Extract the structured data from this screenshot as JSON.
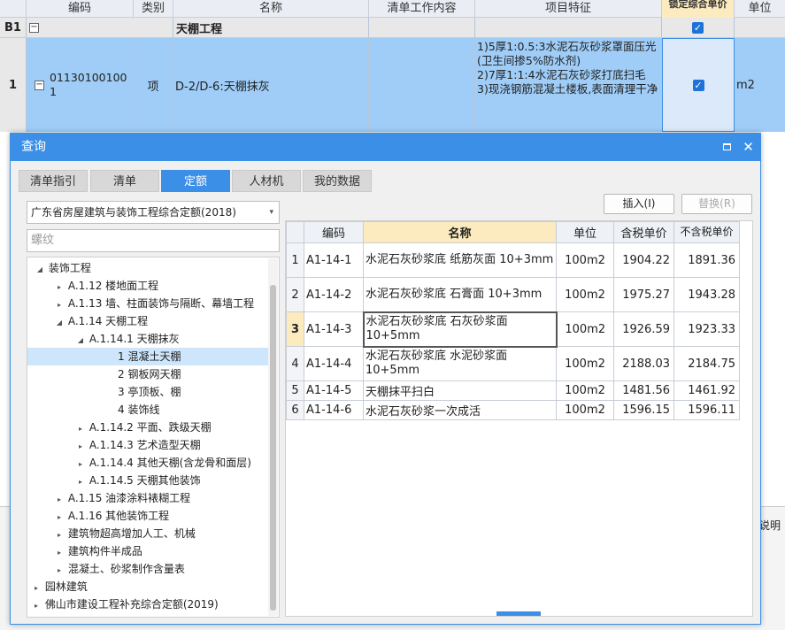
{
  "bg_table": {
    "headers": [
      "编码",
      "类别",
      "名称",
      "清单工作内容",
      "项目特征",
      "锁定综合单价",
      "单位"
    ],
    "b1_row": {
      "index": "B1",
      "name": "天棚工程"
    },
    "row1": {
      "index": "1",
      "code": "011301001001",
      "category": "项",
      "name": "D-2/D-6:天棚抹灰",
      "features": [
        "1)5厚1:0.5:3水泥石灰砂浆罩面压光(卫生间掺5%防水剂)",
        "2)7厚1:1:4水泥石灰砂浆打底扫毛",
        "3)现浇钢筋混凝土楼板,表面清理干净"
      ],
      "unit": "m2"
    },
    "right_edge_text": "说明",
    "collapse_symbol": "−",
    "check_symbol": "✓"
  },
  "dialog": {
    "title": "查询",
    "tabs": [
      "清单指引",
      "清单",
      "定额",
      "人材机",
      "我的数据"
    ],
    "active_tab": "定额",
    "quota_library": "广东省房屋建筑与装饰工程综合定额(2018)",
    "search_placeholder": "螺纹",
    "insert_button": "插入(I)",
    "replace_button": "替换(R)",
    "tree": [
      {
        "label": "装饰工程",
        "level": 1,
        "state": "expanded"
      },
      {
        "label": "A.1.12 楼地面工程",
        "level": 2,
        "state": "collapsed"
      },
      {
        "label": "A.1.13 墙、柱面装饰与隔断、幕墙工程",
        "level": 2,
        "state": "collapsed"
      },
      {
        "label": "A.1.14 天棚工程",
        "level": 2,
        "state": "expanded"
      },
      {
        "label": "A.1.14.1 天棚抹灰",
        "level": 3,
        "state": "expanded"
      },
      {
        "label": "1 混凝土天棚",
        "level": 4,
        "state": "leaf",
        "selected": true
      },
      {
        "label": "2 钢板网天棚",
        "level": 4,
        "state": "leaf"
      },
      {
        "label": "3 亭顶板、棚",
        "level": 4,
        "state": "leaf"
      },
      {
        "label": "4 装饰线",
        "level": 4,
        "state": "leaf"
      },
      {
        "label": "A.1.14.2 平面、跌级天棚",
        "level": 3,
        "state": "collapsed"
      },
      {
        "label": "A.1.14.3 艺术造型天棚",
        "level": 3,
        "state": "collapsed"
      },
      {
        "label": "A.1.14.4 其他天棚(含龙骨和面层)",
        "level": 3,
        "state": "collapsed"
      },
      {
        "label": "A.1.14.5 天棚其他装饰",
        "level": 3,
        "state": "collapsed"
      },
      {
        "label": "A.1.15 油漆涂料裱糊工程",
        "level": 2,
        "state": "collapsed"
      },
      {
        "label": "A.1.16 其他装饰工程",
        "level": 2,
        "state": "collapsed"
      },
      {
        "label": "建筑物超高增加人工、机械",
        "level": 2,
        "state": "collapsed"
      },
      {
        "label": "建筑构件半成品",
        "level": 2,
        "state": "collapsed"
      },
      {
        "label": "混凝土、砂浆制作含量表",
        "level": 2,
        "state": "collapsed"
      },
      {
        "label": "园林建筑",
        "level": 1,
        "state": "collapsed"
      },
      {
        "label": "佛山市建设工程补充综合定额(2019)",
        "level": 1,
        "state": "collapsed"
      }
    ],
    "grid": {
      "headers": [
        "",
        "编码",
        "名称",
        "单位",
        "含税单价",
        "不含税单价"
      ],
      "rows": [
        {
          "idx": "1",
          "code": "A1-14-1",
          "name": "水泥石灰砂浆底 纸筋灰面 10+3mm",
          "unit": "100m2",
          "price_tax": "1904.22",
          "price_notax": "1891.36"
        },
        {
          "idx": "2",
          "code": "A1-14-2",
          "name": "水泥石灰砂浆底 石膏面 10+3mm",
          "unit": "100m2",
          "price_tax": "1975.27",
          "price_notax": "1943.28"
        },
        {
          "idx": "3",
          "code": "A1-14-3",
          "name": "水泥石灰砂浆底 石灰砂浆面 10+5mm",
          "unit": "100m2",
          "price_tax": "1926.59",
          "price_notax": "1923.33",
          "selected": true
        },
        {
          "idx": "4",
          "code": "A1-14-4",
          "name": "水泥石灰砂浆底 水泥砂浆面 10+5mm",
          "unit": "100m2",
          "price_tax": "2188.03",
          "price_notax": "2184.75"
        },
        {
          "idx": "5",
          "code": "A1-14-5",
          "name": "天棚抹平扫白",
          "unit": "100m2",
          "price_tax": "1481.56",
          "price_notax": "1461.92"
        },
        {
          "idx": "6",
          "code": "A1-14-6",
          "name": "水泥石灰砂浆一次成活",
          "unit": "100m2",
          "price_tax": "1596.15",
          "price_notax": "1596.11"
        }
      ]
    }
  }
}
